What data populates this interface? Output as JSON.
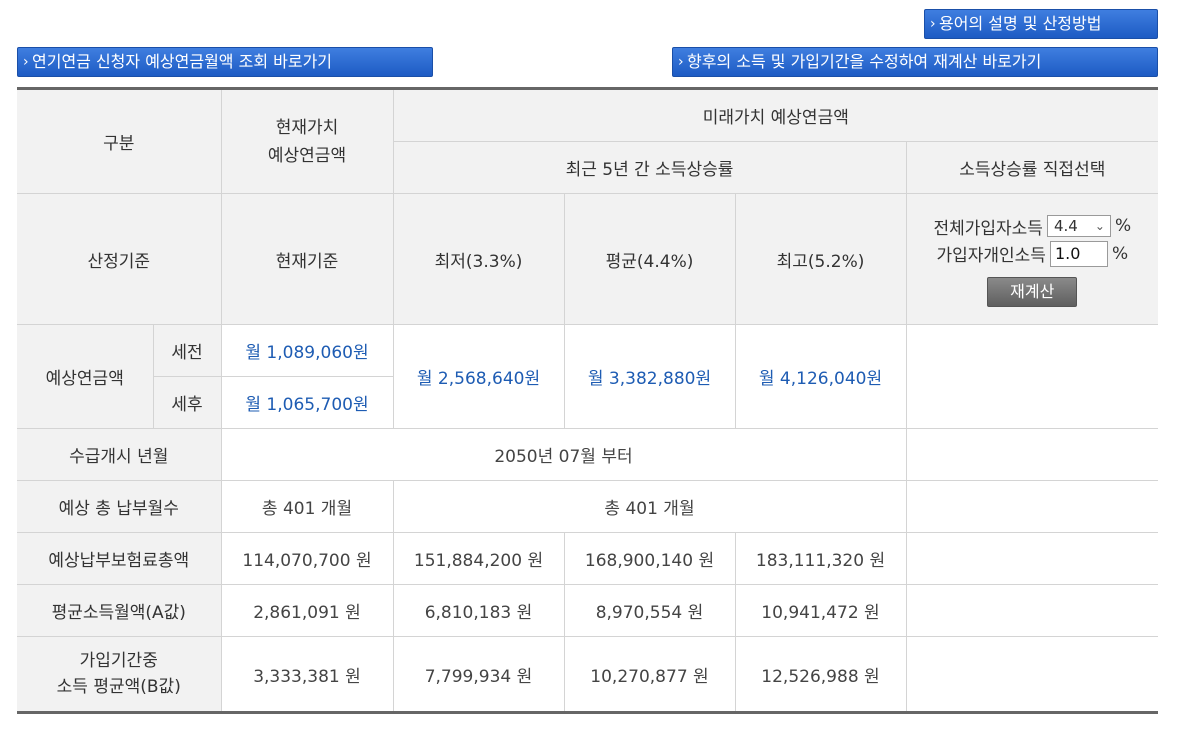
{
  "buttons": {
    "terms": "용어의 설명 및 산정방법",
    "lookup": "연기연금 신청자 예상연금월액 조회 바로가기",
    "recalc_link": "향후의 소득 및 가입기간을 수정하여 재계산 바로가기",
    "recalc": "재계산"
  },
  "table": {
    "header": {
      "category": "구분",
      "present_value": "현재가치\n예상연금액",
      "future_value": "미래가치 예상연금액",
      "recent_growth": "최근 5년 간 소득상승률",
      "direct_select": "소득상승률 직접선택"
    },
    "basis": {
      "label": "산정기준",
      "current": "현재기준",
      "low": "최저(3.3%)",
      "avg": "평균(4.4%)",
      "high": "최고(5.2%)"
    },
    "controls": {
      "all_income_label": "전체가입자소득",
      "all_income_value": "4.4",
      "personal_income_label": "가입자개인소득",
      "personal_income_value": "1.0",
      "percent": "%"
    },
    "pension": {
      "label": "예상연금액",
      "pre_tax_label": "세전",
      "post_tax_label": "세후",
      "pre_tax_current": "월 1,089,060원",
      "post_tax_current": "월 1,065,700원",
      "low": "월 2,568,640원",
      "avg": "월 3,382,880원",
      "high": "월 4,126,040원"
    },
    "start": {
      "label": "수급개시 년월",
      "value": "2050년 07월 부터"
    },
    "months": {
      "label": "예상 총 납부월수",
      "current": "총 401 개월",
      "future": "총 401 개월"
    },
    "premium": {
      "label": "예상납부보험료총액",
      "current": "114,070,700 원",
      "low": "151,884,200 원",
      "avg": "168,900,140 원",
      "high": "183,111,320 원"
    },
    "a_value": {
      "label": "평균소득월액(A값)",
      "current": "2,861,091 원",
      "low": "6,810,183 원",
      "avg": "8,970,554 원",
      "high": "10,941,472 원"
    },
    "b_value": {
      "label_line1": "가입기간중",
      "label_line2": "소득 평균액(B값)",
      "current": "3,333,381 원",
      "low": "7,799,934 원",
      "avg": "10,270,877 원",
      "high": "12,526,988 원"
    }
  }
}
